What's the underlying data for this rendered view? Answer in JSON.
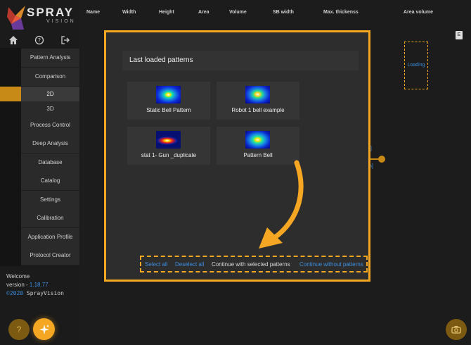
{
  "brand": {
    "name": "SPRAY",
    "tagline": "VISION"
  },
  "sidebar": {
    "nav": [
      {
        "label": "Pattern Analysis"
      },
      {
        "label": "Comparison"
      },
      {
        "label": "2D"
      },
      {
        "label": "3D"
      },
      {
        "label": "Process Control"
      },
      {
        "label": "Deep Analysis"
      },
      {
        "label": "Database"
      },
      {
        "label": "Catalog"
      },
      {
        "label": "Settings"
      },
      {
        "label": "Calibration"
      },
      {
        "label": "Application Profile"
      },
      {
        "label": "Protocol Creator"
      }
    ],
    "active": "2D"
  },
  "footer": {
    "welcome": "Welcome",
    "version_label": "version - ",
    "version": "1.18.77",
    "copyright_year": "©2020",
    "company": "SprayVision"
  },
  "table": {
    "columns": [
      "Name",
      "Width",
      "Height",
      "Area",
      "Volume",
      "SB width",
      "Max. thickenss",
      "Area volume"
    ],
    "loading": "Loading",
    "fragment1": "b]",
    "fragment2": "m]"
  },
  "modal": {
    "title": "Last loaded patterns",
    "patterns": [
      {
        "label": "Static Bell Pattern"
      },
      {
        "label": "Robot 1 bell example"
      },
      {
        "label": "stat 1- Gun _duplicate"
      },
      {
        "label": "Pattern Bell"
      }
    ],
    "actions": {
      "select_all": "Select all",
      "deselect_all": "Deselect all",
      "continue_selected": "Continue with selected patterns",
      "continue_without": "Continue without patterns"
    }
  },
  "colors": {
    "accent": "#f5a623",
    "link": "#3c8dde",
    "panel": "#2d2d2d"
  }
}
